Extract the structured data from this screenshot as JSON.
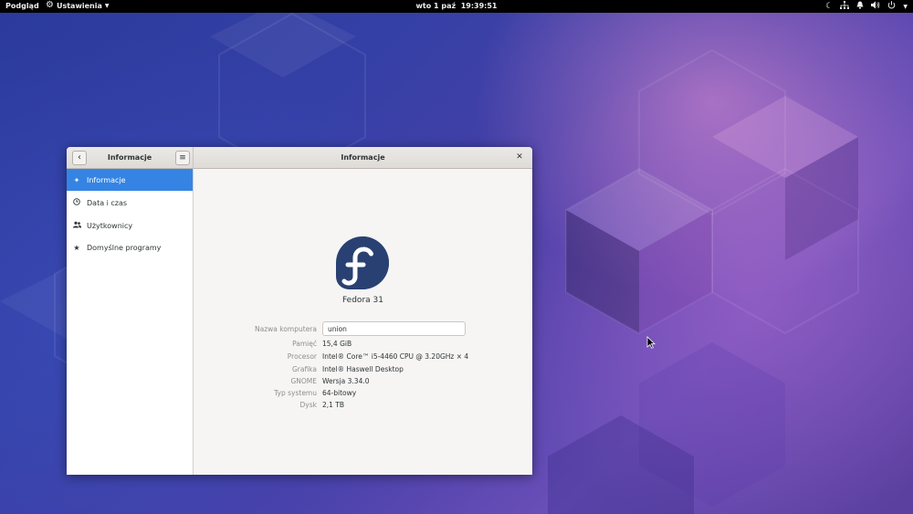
{
  "topbar": {
    "activities": "Podgląd",
    "app_menu": "Ustawienia",
    "clock": "wto 1 paź  19:39:51",
    "tray_icons": [
      "night-light-icon",
      "network-icon",
      "notifications-icon",
      "volume-icon",
      "power-icon"
    ]
  },
  "window": {
    "sidebar_title": "Informacje",
    "main_title": "Informacje",
    "back_icon": "chevron-left-icon",
    "menu_icon": "hamburger-menu-icon",
    "close_icon": "close-icon"
  },
  "sidebar": {
    "items": [
      {
        "label": "Informacje",
        "icon": "sparkle-icon",
        "active": true
      },
      {
        "label": "Data i czas",
        "icon": "clock-icon",
        "active": false
      },
      {
        "label": "Użytkownicy",
        "icon": "users-icon",
        "active": false
      },
      {
        "label": "Domyślne programy",
        "icon": "star-icon",
        "active": false
      }
    ]
  },
  "info": {
    "distro_name": "Fedora 31",
    "device_name_label": "Nazwa komputera",
    "device_name_value": "union",
    "rows": [
      {
        "label": "Pamięć",
        "value": "15,4 GiB"
      },
      {
        "label": "Procesor",
        "value": "Intel® Core™ i5-4460 CPU @ 3.20GHz × 4"
      },
      {
        "label": "Grafika",
        "value": "Intel® Haswell Desktop"
      },
      {
        "label": "GNOME",
        "value": "Wersja 3.34.0"
      },
      {
        "label": "Typ systemu",
        "value": "64-bitowy"
      },
      {
        "label": "Dysk",
        "value": "2,1 TB"
      }
    ]
  },
  "colors": {
    "accent": "#3584e4",
    "fedora_blue": "#294172",
    "fedora_light": "#3c6eb4",
    "topbar": "#000000"
  }
}
